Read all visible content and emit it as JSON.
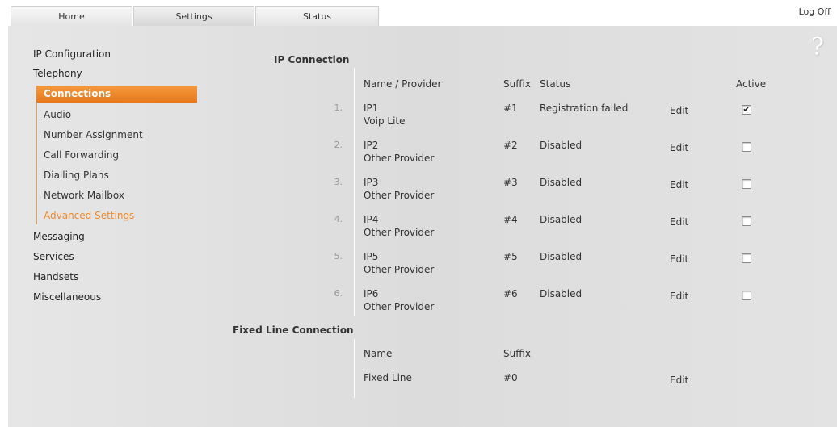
{
  "tabs": {
    "home": "Home",
    "settings": "Settings",
    "status": "Status"
  },
  "header": {
    "log_off": "Log Off"
  },
  "help_icon": "?",
  "sidebar": {
    "items": [
      {
        "label": "IP Configuration"
      },
      {
        "label": "Telephony"
      },
      {
        "label": "Messaging"
      },
      {
        "label": "Services"
      },
      {
        "label": "Handsets"
      },
      {
        "label": "Miscellaneous"
      }
    ],
    "telephony_sub": [
      {
        "label": "Connections"
      },
      {
        "label": "Audio"
      },
      {
        "label": "Number Assignment"
      },
      {
        "label": "Call Forwarding"
      },
      {
        "label": "Dialling Plans"
      },
      {
        "label": "Network Mailbox"
      },
      {
        "label": "Advanced Settings"
      }
    ],
    "accent_color": "#ef8a2d"
  },
  "ip_connection": {
    "title": "IP Connection",
    "headers": {
      "name": "Name / Provider",
      "suffix": "Suffix",
      "status": "Status",
      "active": "Active"
    },
    "rows": [
      {
        "index": "1.",
        "name": "IP1",
        "provider": "Voip Lite",
        "suffix": "#1",
        "status": "Registration failed",
        "edit": "Edit",
        "active": true,
        "mark": "✔"
      },
      {
        "index": "2.",
        "name": "IP2",
        "provider": "Other Provider",
        "suffix": "#2",
        "status": "Disabled",
        "edit": "Edit",
        "active": false,
        "mark": ""
      },
      {
        "index": "3.",
        "name": "IP3",
        "provider": "Other Provider",
        "suffix": "#3",
        "status": "Disabled",
        "edit": "Edit",
        "active": false,
        "mark": ""
      },
      {
        "index": "4.",
        "name": "IP4",
        "provider": "Other Provider",
        "suffix": "#4",
        "status": "Disabled",
        "edit": "Edit",
        "active": false,
        "mark": ""
      },
      {
        "index": "5.",
        "name": "IP5",
        "provider": "Other Provider",
        "suffix": "#5",
        "status": "Disabled",
        "edit": "Edit",
        "active": false,
        "mark": ""
      },
      {
        "index": "6.",
        "name": "IP6",
        "provider": "Other Provider",
        "suffix": "#6",
        "status": "Disabled",
        "edit": "Edit",
        "active": false,
        "mark": ""
      }
    ]
  },
  "fixed_line": {
    "title": "Fixed Line Connection",
    "headers": {
      "name": "Name",
      "suffix": "Suffix"
    },
    "row": {
      "name": "Fixed Line",
      "suffix": "#0",
      "edit": "Edit"
    }
  }
}
